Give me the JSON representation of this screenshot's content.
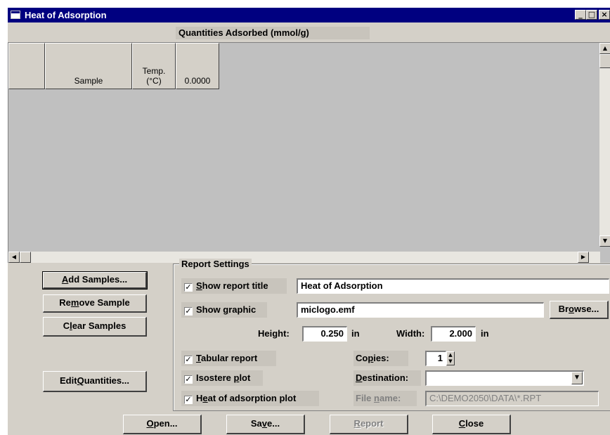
{
  "window": {
    "title": "Heat of Adsorption",
    "controls": {
      "minimize": "_",
      "maximize": "□",
      "close": "×"
    }
  },
  "grid": {
    "caption": "Quantities Adsorbed (mmol/g)",
    "columns": [
      {
        "label": ""
      },
      {
        "label": "Sample"
      },
      {
        "label_line1": "Temp.",
        "label_line2": "(°C)"
      },
      {
        "label": "0.0000"
      }
    ],
    "scroll": {
      "up": "▲",
      "down": "▼",
      "left": "◀",
      "right": "▶"
    }
  },
  "buttons": {
    "add_samples": {
      "pre": "",
      "key": "A",
      "post": "dd Samples..."
    },
    "remove_sample": {
      "pre": "Re",
      "key": "m",
      "post": "ove Sample"
    },
    "clear_samples": {
      "pre": "C",
      "key": "l",
      "post": "ear Samples"
    },
    "edit_quantities": {
      "pre": "Edit ",
      "key": "Q",
      "post": "uantities..."
    },
    "browse": {
      "pre": "Br",
      "key": "o",
      "post": "wse..."
    },
    "open": {
      "pre": "",
      "key": "O",
      "post": "pen..."
    },
    "save": {
      "pre": "Sa",
      "key": "v",
      "post": "e..."
    },
    "report": {
      "pre": "",
      "key": "R",
      "post": "eport"
    },
    "close": {
      "pre": "",
      "key": "C",
      "post": "lose"
    }
  },
  "report_settings": {
    "legend": "Report Settings",
    "show_report_title": {
      "pre": "",
      "key": "S",
      "post": "how report title",
      "checked": true
    },
    "report_title_value": "Heat of Adsorption",
    "show_graphic": {
      "pre": "Show ",
      "key": "g",
      "post": "raphic",
      "checked": true
    },
    "graphic_file_value": "miclogo.emf",
    "height_label": "Height:",
    "height_value": "0.250",
    "height_unit": "in",
    "width_label": "Width:",
    "width_value": "2.000",
    "width_unit": "in",
    "tabular_report": {
      "pre": "",
      "key": "T",
      "post": "abular report",
      "checked": true
    },
    "isostere_plot": {
      "pre": "Isostere ",
      "key": "p",
      "post": "lot",
      "checked": true
    },
    "heat_plot": {
      "pre": "H",
      "key": "e",
      "post": "at of adsorption plot",
      "checked": true
    },
    "copies": {
      "pre": "Co",
      "key": "p",
      "post": "ies:"
    },
    "copies_value": "1",
    "destination": {
      "pre": "",
      "key": "D",
      "post": "estination:"
    },
    "destination_value": "",
    "file_name": {
      "pre": "File ",
      "key": "n",
      "post": "ame:"
    },
    "file_name_value": "C:\\DEMO2050\\DATA\\*.RPT",
    "check_mark": "✓"
  }
}
